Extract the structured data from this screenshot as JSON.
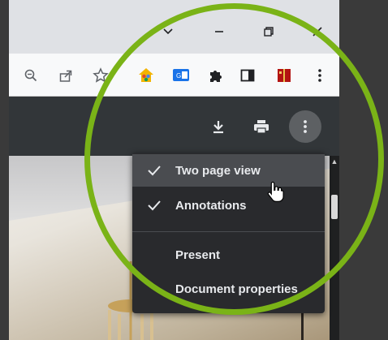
{
  "window": {
    "controls": {
      "chevron": "chevron-down-icon",
      "minimize": "minimize-icon",
      "restore": "restore-icon",
      "close": "close-icon"
    }
  },
  "toolbar": {
    "icons": [
      "zoom-out-icon",
      "share-icon",
      "bookmark-star-icon",
      "extension-home-icon",
      "extension-translate-icon",
      "extensions-puzzle-icon",
      "side-panel-icon",
      "extension-book-icon",
      "browser-menu-icon"
    ]
  },
  "pdf_toolbar": {
    "icons": [
      "download-icon",
      "print-icon",
      "more-options-icon"
    ]
  },
  "menu": {
    "items": [
      {
        "label": "Two page view",
        "checked": true,
        "hovered": true
      },
      {
        "label": "Annotations",
        "checked": true,
        "hovered": false
      },
      {
        "label": "Present",
        "checked": false,
        "hovered": false
      },
      {
        "label": "Document properties",
        "checked": false,
        "hovered": false
      }
    ]
  },
  "colors": {
    "highlight_ring": "#7ab317",
    "menu_bg": "#292a2d",
    "pdf_toolbar_bg": "#323639"
  }
}
